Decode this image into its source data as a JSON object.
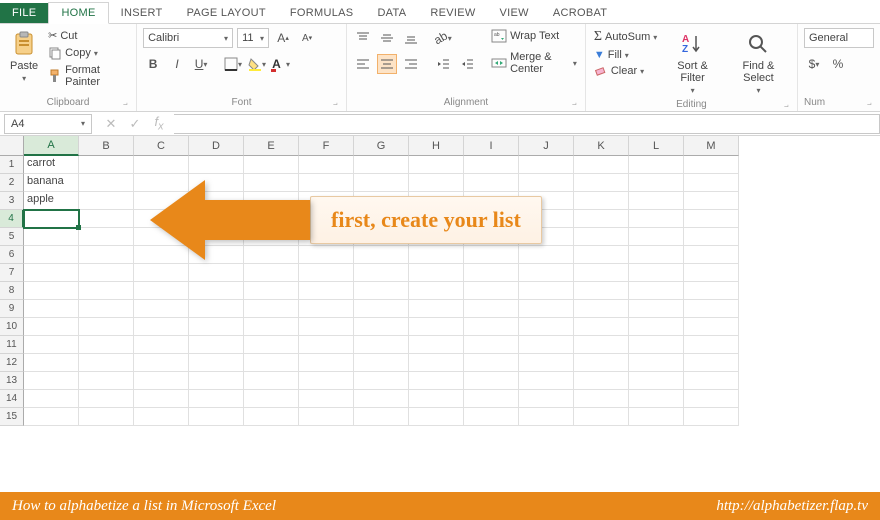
{
  "tabs": [
    "FILE",
    "HOME",
    "INSERT",
    "PAGE LAYOUT",
    "FORMULAS",
    "DATA",
    "REVIEW",
    "VIEW",
    "ACROBAT"
  ],
  "active_tab": "HOME",
  "ribbon": {
    "clipboard": {
      "paste": "Paste",
      "cut": "Cut",
      "copy": "Copy",
      "painter": "Format Painter",
      "label": "Clipboard"
    },
    "font": {
      "name": "Calibri",
      "size": "11",
      "label": "Font"
    },
    "alignment": {
      "wrap": "Wrap Text",
      "merge": "Merge & Center",
      "label": "Alignment"
    },
    "editing": {
      "autosum": "AutoSum",
      "fill": "Fill",
      "clear": "Clear",
      "sort": "Sort & Filter",
      "find": "Find & Select",
      "label": "Editing"
    },
    "number": {
      "format": "General",
      "label": "Num"
    }
  },
  "namebox": "A4",
  "columns": [
    "A",
    "B",
    "C",
    "D",
    "E",
    "F",
    "G",
    "H",
    "I",
    "J",
    "K",
    "L",
    "M"
  ],
  "rows": 15,
  "selected_col": 0,
  "selected_row": 3,
  "cells": {
    "A1": "carrot",
    "A2": "banana",
    "A3": "apple"
  },
  "annotation": "first, create your list",
  "footer": {
    "left": "How to alphabetize a list in Microsoft Excel",
    "right": "http://alphabetizer.flap.tv"
  },
  "colors": {
    "accent": "#217346",
    "orange": "#e8881a"
  }
}
